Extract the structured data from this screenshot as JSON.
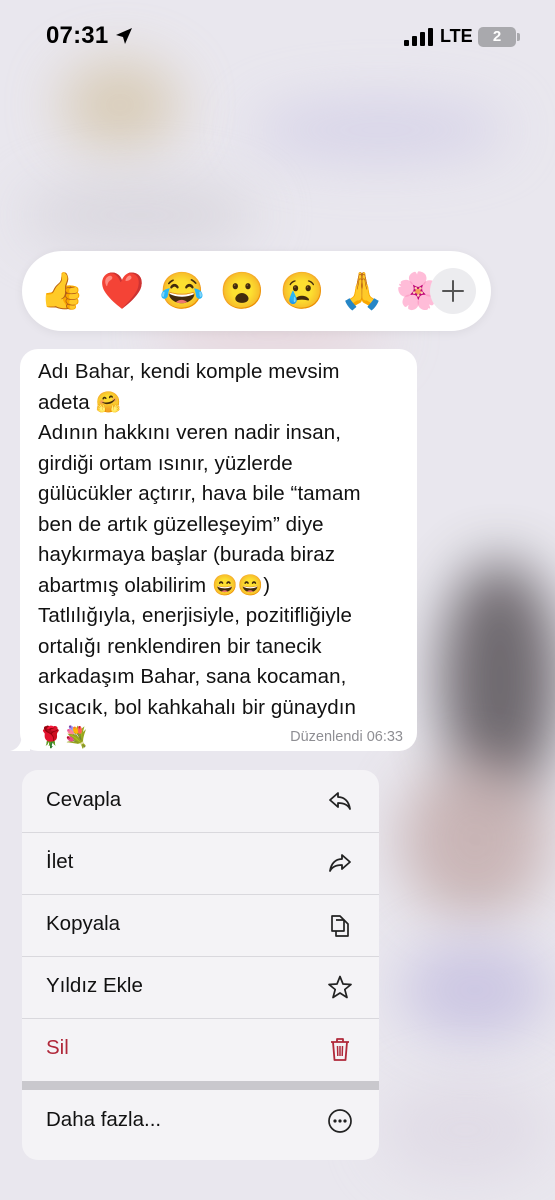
{
  "status_bar": {
    "time": "07:31",
    "network": "LTE",
    "battery": "2"
  },
  "reactions": [
    {
      "emoji": "👍",
      "name": "thumbs-up"
    },
    {
      "emoji": "❤️",
      "name": "red-heart"
    },
    {
      "emoji": "😂",
      "name": "tears-of-joy"
    },
    {
      "emoji": "😮",
      "name": "open-mouth"
    },
    {
      "emoji": "😢",
      "name": "crying"
    },
    {
      "emoji": "🙏",
      "name": "folded-hands"
    },
    {
      "emoji": "🌸",
      "name": "cherry-blossom"
    }
  ],
  "message": {
    "text": "Adı Bahar, kendi komple mevsim\nadeta 🤗\nAdının hakkını veren nadir insan,\ngirdiği ortam ısınır, yüzlerde\ngülücükler açtırır, hava bile “tamam\nben de artık güzelleşeyim” diye\nhaykırmaya başlar (burada biraz\nabartmış olabilirim 😄😄)\nTatlılığıyla, enerjisiyle, pozitifliğiyle\nortalığı renklendiren bir tanecik\narkadaşım Bahar, sana kocaman,\nsıcacık, bol kahkahalı bir günaydın\n🌹💐",
    "meta": "Düzenlendi 06:33"
  },
  "menu": {
    "items": [
      {
        "label": "Cevapla",
        "icon": "reply-icon"
      },
      {
        "label": "İlet",
        "icon": "forward-icon"
      },
      {
        "label": "Kopyala",
        "icon": "copy-icon"
      },
      {
        "label": "Yıldız Ekle",
        "icon": "star-icon"
      },
      {
        "label": "Sil",
        "icon": "trash-icon"
      },
      {
        "label": "Daha fazla...",
        "icon": "more-icon"
      }
    ]
  },
  "colors": {
    "danger": "#b0283a",
    "menu_bg": "#f4f3f6",
    "bubble_bg": "#ffffff"
  }
}
